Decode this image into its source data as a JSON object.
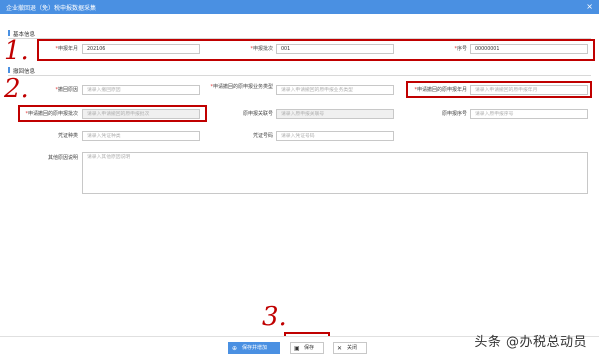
{
  "window": {
    "title": "企业撤回退（免）税申报数据采集",
    "close_glyph": "×"
  },
  "basic_section": {
    "title": "基本信息"
  },
  "basic": {
    "period_label": "申报年月",
    "period_value": "202106",
    "batch_label": "申报批次",
    "batch_value": "001",
    "seq_label": "序号",
    "seq_value": "00000001"
  },
  "withdraw_section": {
    "title": "撤回信息"
  },
  "withdraw": {
    "reason_label": "撤回原因",
    "reason_placeholder": "请录入撤回原因",
    "biz_type_label": "申请撤回的原申报业务类型",
    "biz_type_placeholder": "请录入申请撤回的原申报业务类型",
    "orig_period_label": "申请撤回的原申报年月",
    "orig_period_placeholder": "请录入申请撤回的原申报年月",
    "orig_batch_label": "申请撤回的原申报批次",
    "orig_batch_placeholder": "请录入申请撤回的原申报批次",
    "orig_assoc_label": "原申报关联号",
    "orig_assoc_placeholder": "请录入原申报关联号",
    "orig_seq_label": "原申报序号",
    "orig_seq_placeholder": "请录入原申报序号",
    "voucher_type_label": "凭证种类",
    "voucher_type_placeholder": "请录入凭证种类",
    "voucher_no_label": "凭证号码",
    "voucher_no_placeholder": "请录入凭证号码",
    "other_reason_label": "其他原因说明",
    "other_reason_placeholder": "请录入其他原因说明"
  },
  "annotations": {
    "a1": "1.",
    "a2": "2.",
    "a3": "3."
  },
  "footer": {
    "save_add_label": "保存并增加",
    "save_label": "保存",
    "close_label": "关闭",
    "save_add_icon": "save-plus-icon",
    "save_icon": "save-icon",
    "close_icon": "close-icon"
  },
  "watermark": {
    "text": "头条 @办税总动员"
  },
  "colors": {
    "accent": "#4a90e2",
    "annotation_red": "#c00000",
    "required": "#e03030"
  }
}
